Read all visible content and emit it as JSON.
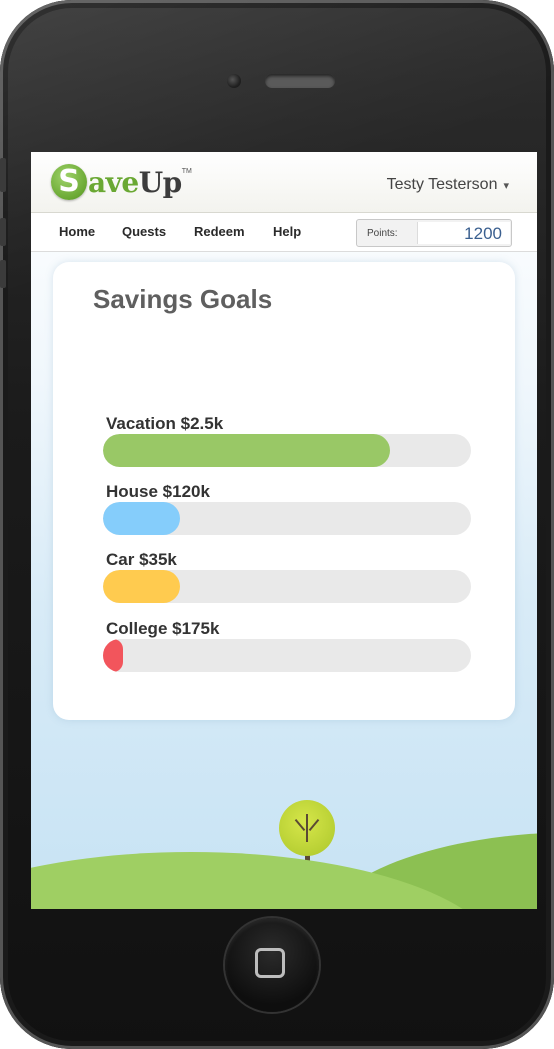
{
  "header": {
    "logo": {
      "s": "S",
      "ave": "ave",
      "up": "Up",
      "tm": "TM"
    },
    "user_name": "Testy Testerson",
    "user_caret": "▾"
  },
  "nav": {
    "items": [
      {
        "label": "Home"
      },
      {
        "label": "Quests"
      },
      {
        "label": "Redeem"
      },
      {
        "label": "Help"
      }
    ],
    "points_label": "Points:",
    "points_value": "1200"
  },
  "page": {
    "title": "Savings Goals"
  },
  "goals": [
    {
      "label": "Vacation $2.5k",
      "progress": 0.78,
      "color": "#99c866"
    },
    {
      "label": "House $120k",
      "progress": 0.21,
      "color": "#85cdfb"
    },
    {
      "label": "Car $35k",
      "progress": 0.21,
      "color": "#ffcb4f"
    },
    {
      "label": "College $175k",
      "progress": 0.055,
      "color": "#f2555c"
    }
  ],
  "icons": {
    "home_button": "home-square-icon",
    "camera": "camera-icon",
    "speaker": "speaker-icon",
    "user_menu": "chevron-down-icon",
    "tree": "tree-icon"
  }
}
